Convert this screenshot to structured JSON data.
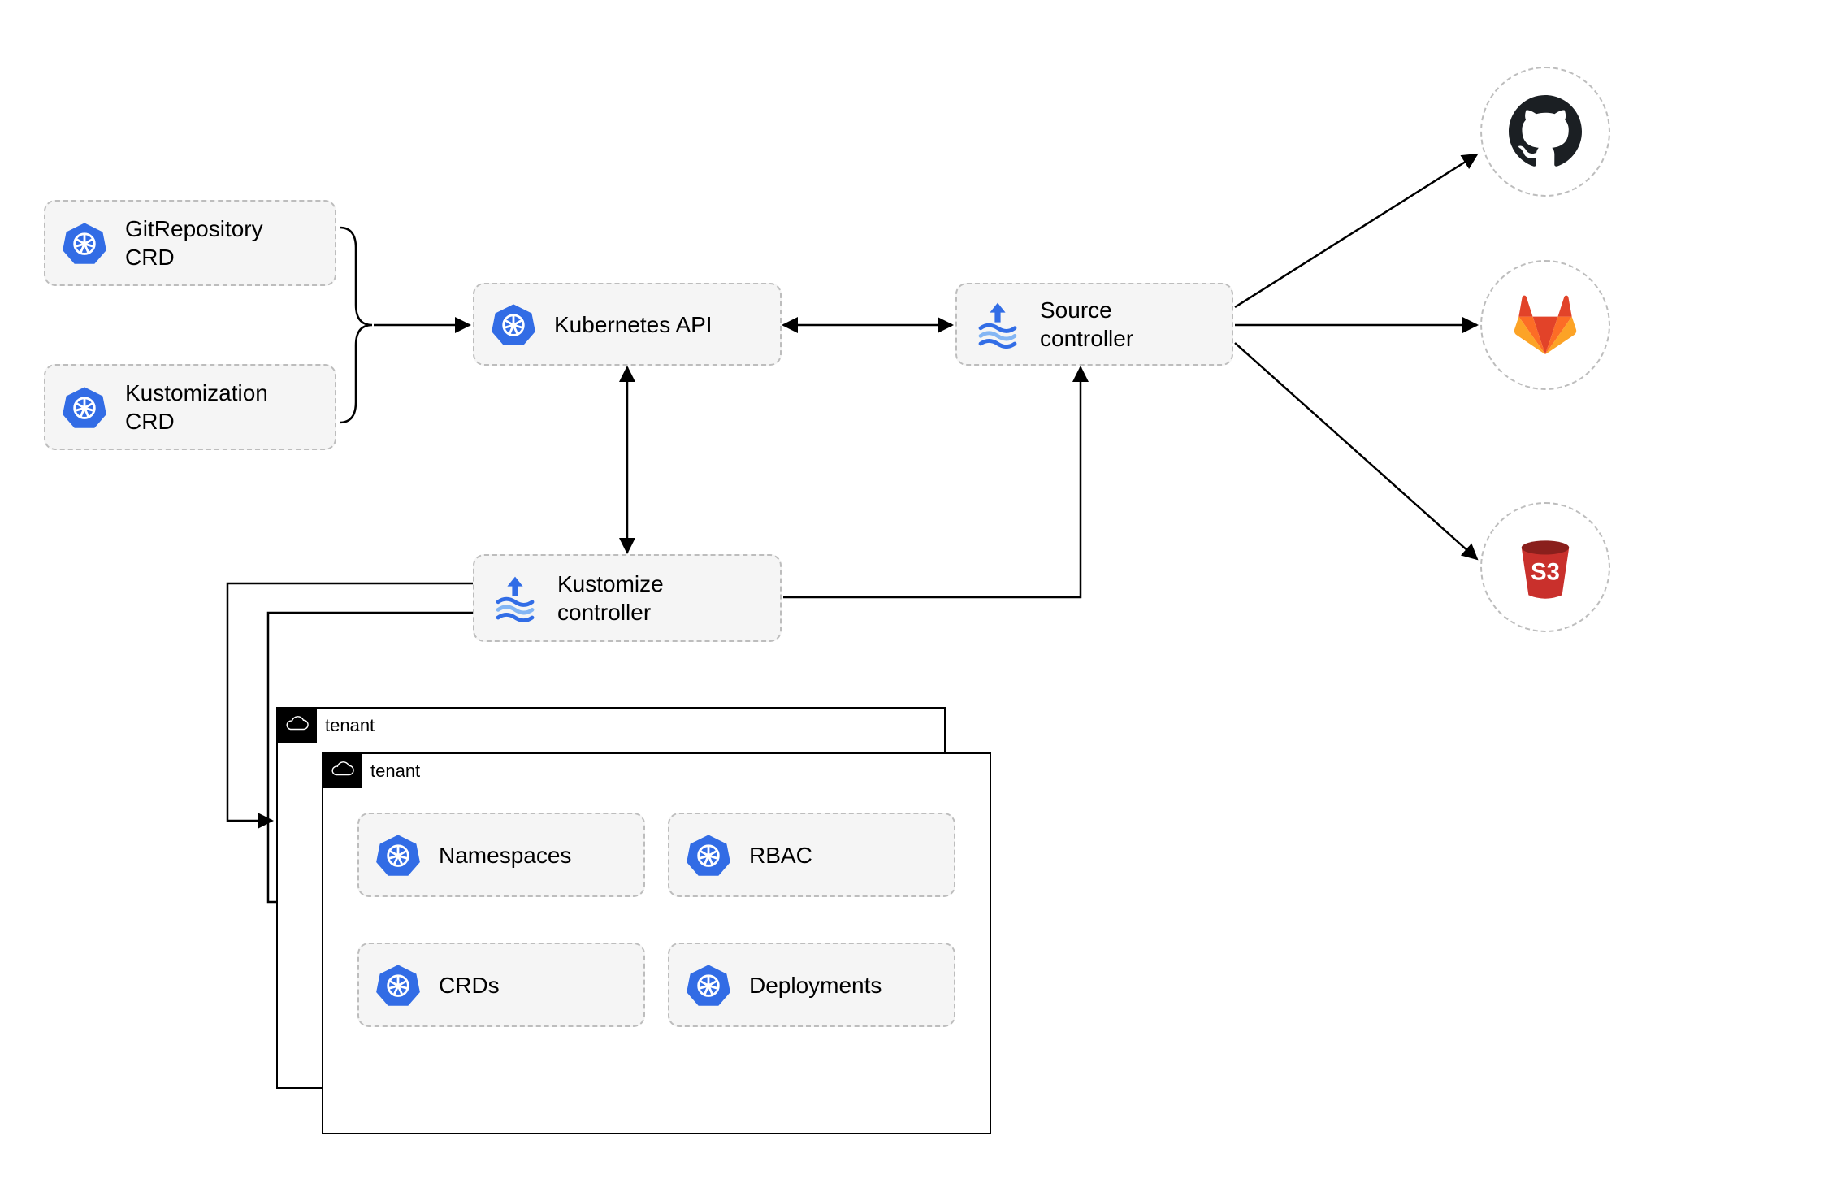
{
  "nodes": {
    "gitrepo_crd": "GitRepository\nCRD",
    "kustomization_crd": "Kustomization\nCRD",
    "k8s_api": "Kubernetes API",
    "source_controller": "Source\ncontroller",
    "kustomize_controller": "Kustomize\ncontroller",
    "namespaces": "Namespaces",
    "rbac": "RBAC",
    "crds": "CRDs",
    "deployments": "Deployments"
  },
  "tenant_label": "tenant",
  "s3_label": "S3",
  "external_sources": [
    "github",
    "gitlab",
    "s3"
  ],
  "edges": [
    "crd-group -> kubernetes-api (one-way)",
    "kubernetes-api <-> source-controller (two-way)",
    "kubernetes-api <-> kustomize-controller (two-way, vertical)",
    "kustomize-controller -> source-controller (one-way, elbow up)",
    "source-controller -> github (one-way)",
    "source-controller -> gitlab (one-way)",
    "source-controller -> s3 (one-way)",
    "kustomize-controller -> tenant-back (one-way, elbow left-down)",
    "kustomize-controller -> tenant-front (one-way, elbow left-down)"
  ],
  "colors": {
    "node_bg": "#f5f5f5",
    "node_border": "#bdbdbd",
    "k8s_blue": "#326ce5",
    "flux_blue": "#326de6",
    "flux_light": "#84b6f4",
    "gitlab_orange": "#fc6d26",
    "gitlab_dark": "#e24329",
    "s3_red": "#c9302c",
    "github_black": "#1b1f23"
  }
}
